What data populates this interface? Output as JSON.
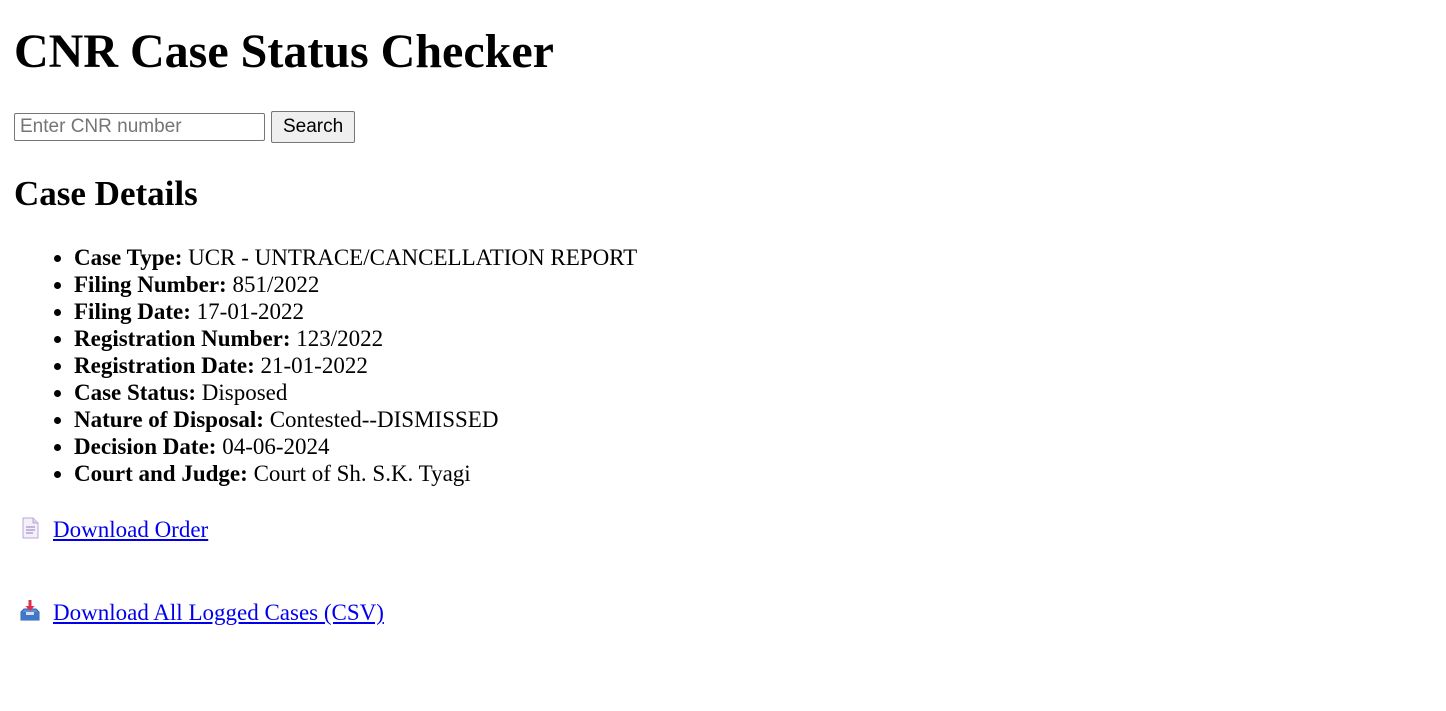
{
  "page": {
    "title": "CNR Case Status Checker"
  },
  "search": {
    "placeholder": "Enter CNR number",
    "value": "",
    "button_label": "Search"
  },
  "details": {
    "heading": "Case Details",
    "items": [
      {
        "label": "Case Type:",
        "value": "UCR - UNTRACE/CANCELLATION REPORT"
      },
      {
        "label": "Filing Number:",
        "value": "851/2022"
      },
      {
        "label": "Filing Date:",
        "value": "17-01-2022"
      },
      {
        "label": "Registration Number:",
        "value": "123/2022"
      },
      {
        "label": "Registration Date:",
        "value": "21-01-2022"
      },
      {
        "label": "Case Status:",
        "value": "Disposed"
      },
      {
        "label": "Nature of Disposal:",
        "value": "Contested--DISMISSED"
      },
      {
        "label": "Decision Date:",
        "value": "04-06-2024"
      },
      {
        "label": "Court and Judge:",
        "value": "Court of Sh. S.K. Tyagi"
      }
    ]
  },
  "links": {
    "download_order": {
      "label": "Download Order",
      "icon": "page-document-icon"
    },
    "download_csv": {
      "label": "Download All Logged Cases (CSV)",
      "icon": "inbox-tray-icon"
    }
  },
  "colors": {
    "link": "#0000ee",
    "text": "#000000",
    "background": "#ffffff"
  }
}
